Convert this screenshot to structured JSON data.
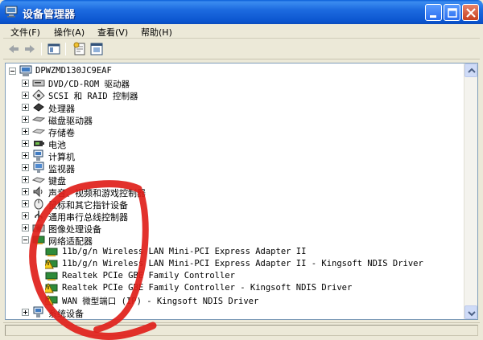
{
  "window": {
    "title": "设备管理器",
    "controls": [
      "minimize",
      "maximize",
      "close"
    ]
  },
  "menu": [
    {
      "label": "文件(F)"
    },
    {
      "label": "操作(A)"
    },
    {
      "label": "查看(V)"
    },
    {
      "label": "帮助(H)"
    }
  ],
  "toolbar": {
    "buttons": [
      "back-arrow-icon",
      "forward-arrow-icon",
      "properties-icon",
      "help-icon",
      "list-view-icon"
    ]
  },
  "tree": {
    "root": "DPWZMD130JC9EAF",
    "categories": [
      {
        "label": "DVD/CD-ROM 驱动器",
        "icon": "cdrom-icon",
        "expanded": false
      },
      {
        "label": "SCSI 和 RAID 控制器",
        "icon": "scsi-icon",
        "expanded": false
      },
      {
        "label": "处理器",
        "icon": "processor-icon",
        "expanded": false
      },
      {
        "label": "磁盘驱动器",
        "icon": "disk-drive-icon",
        "expanded": false
      },
      {
        "label": "存储卷",
        "icon": "storage-volume-icon",
        "expanded": false
      },
      {
        "label": "电池",
        "icon": "battery-icon",
        "expanded": false
      },
      {
        "label": "计算机",
        "icon": "computer-icon",
        "expanded": false
      },
      {
        "label": "监视器",
        "icon": "monitor-icon",
        "expanded": false
      },
      {
        "label": "键盘",
        "icon": "keyboard-icon",
        "expanded": false
      },
      {
        "label": "声音、视频和游戏控制器",
        "icon": "sound-icon",
        "expanded": false
      },
      {
        "label": "鼠标和其它指针设备",
        "icon": "mouse-icon",
        "expanded": false
      },
      {
        "label": "通用串行总线控制器",
        "icon": "usb-icon",
        "expanded": false
      },
      {
        "label": "图像处理设备",
        "icon": "imaging-icon",
        "expanded": false
      },
      {
        "label": "网络适配器",
        "icon": "network-adapter-icon",
        "expanded": true
      },
      {
        "label": "系统设备",
        "icon": "system-device-icon",
        "expanded": false
      }
    ],
    "network_adapters": [
      {
        "label": "11b/g/n  Wireless LAN Mini-PCI Express Adapter II",
        "warning": false
      },
      {
        "label": "11b/g/n  Wireless LAN Mini-PCI Express Adapter II - Kingsoft NDIS Driver",
        "warning": true
      },
      {
        "label": "Realtek PCIe GBE Family Controller",
        "warning": false
      },
      {
        "label": "Realtek PCIe GBE Family Controller - Kingsoft NDIS Driver",
        "warning": true
      },
      {
        "label": "WAN 微型端口 (IP) - Kingsoft NDIS Driver",
        "warning": true
      }
    ]
  },
  "colors": {
    "title_bar": "#0b55cf",
    "annotation_red": "#e0201a",
    "warning_yellow": "#f5d020"
  }
}
